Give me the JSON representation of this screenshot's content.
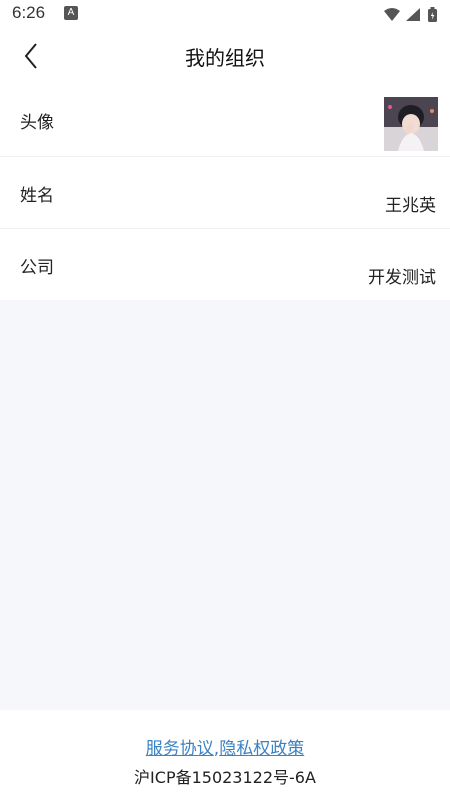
{
  "status_bar": {
    "time": "6:26",
    "app_badge": "A",
    "icons": [
      "wifi-icon",
      "signal-icon",
      "battery-charging-icon"
    ]
  },
  "header": {
    "title": "我的组织",
    "back_icon": "chevron-left-icon"
  },
  "profile": {
    "avatar_label": "头像",
    "name_label": "姓名",
    "name_value": "王兆英",
    "company_label": "公司",
    "company_value": "开发测试"
  },
  "footer": {
    "service_agreement": "服务协议",
    "separator": ",",
    "privacy_policy": "隐私权政策",
    "icp": "沪ICP备15023122号-6A"
  },
  "colors": {
    "link": "#3b82c4",
    "background": "#f6f7fb",
    "surface": "#ffffff"
  }
}
